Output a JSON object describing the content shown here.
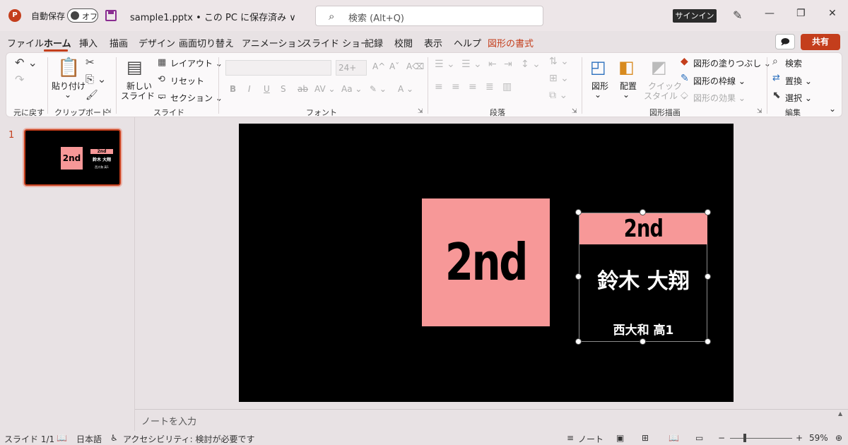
{
  "titlebar": {
    "app_logo": "P",
    "autosave_label": "自動保存",
    "autosave_state": "オフ",
    "doc_title": "sample1.pptx • この PC に保存済み ∨",
    "search_placeholder": "検索 (Alt+Q)",
    "signin": "サインイン",
    "minimize": "—",
    "restore": "❐",
    "close": "✕"
  },
  "menu": {
    "tabs": [
      "ファイル",
      "ホーム",
      "挿入",
      "描画",
      "デザイン",
      "画面切り替え",
      "アニメーション",
      "スライド ショー",
      "記録",
      "校閲",
      "表示",
      "ヘルプ",
      "図形の書式"
    ],
    "share": "共有",
    "comment_icon": "🗩"
  },
  "ribbon": {
    "undo_group": {
      "label": "元に戻す",
      "undo": "↶ ⌄",
      "redo": "↷"
    },
    "clipboard": {
      "label": "クリップボード",
      "paste": "貼り付け",
      "paste_arrow": "⌄",
      "cut": "✂",
      "copy": "⎘ ⌄",
      "format_painter": "🖌"
    },
    "slides": {
      "label": "スライド",
      "new_slide_1": "新しい",
      "new_slide_2": "スライド ⌄",
      "layout": "レイアウト ⌄",
      "reset": "リセット",
      "section": "セクション ⌄"
    },
    "font": {
      "label": "フォント",
      "size": "24+",
      "grow": "A^",
      "shrink": "Aˇ",
      "clear": "A⌫",
      "bold": "B",
      "italic": "I",
      "underline": "U",
      "shadow": "S",
      "strike": "ab",
      "spacing": "AV ⌄",
      "case": "Aa ⌄",
      "highlight": "✎ ⌄",
      "color": "A ⌄"
    },
    "paragraph": {
      "label": "段落"
    },
    "drawing": {
      "label": "図形描画",
      "shapes": "図形",
      "arrange": "配置",
      "quick_styles_1": "クイック",
      "quick_styles_2": "スタイル ⌄",
      "fill": "図形の塗りつぶし ⌄",
      "outline": "図形の枠線 ⌄",
      "effects": "図形の効果 ⌄"
    },
    "editing": {
      "label": "編集",
      "find": "検索",
      "replace": "置換 ⌄",
      "select": "選択 ⌄"
    },
    "collapse": "⌄"
  },
  "thumbnails": {
    "slide_number": "1",
    "box_text": "2nd",
    "header_text": "2nd",
    "name": "鈴木 大翔",
    "school": "西大和 高1"
  },
  "slide": {
    "big_label": "2nd",
    "card_header": "2nd",
    "card_name": "鈴木 大翔",
    "card_school": "西大和 高1"
  },
  "notes": {
    "placeholder": "ノートを入力"
  },
  "status": {
    "slide_count": "スライド 1/1",
    "language": "日本語",
    "accessibility": "アクセシビリティ: 検討が必要です",
    "notes_btn": "ノート",
    "zoom": "59%",
    "zoom_minus": "−",
    "zoom_plus": "+",
    "fit": "⊕"
  },
  "colors": {
    "accent": "#c43e1c",
    "shape_fill": "#f79898",
    "slide_bg": "#000000"
  }
}
